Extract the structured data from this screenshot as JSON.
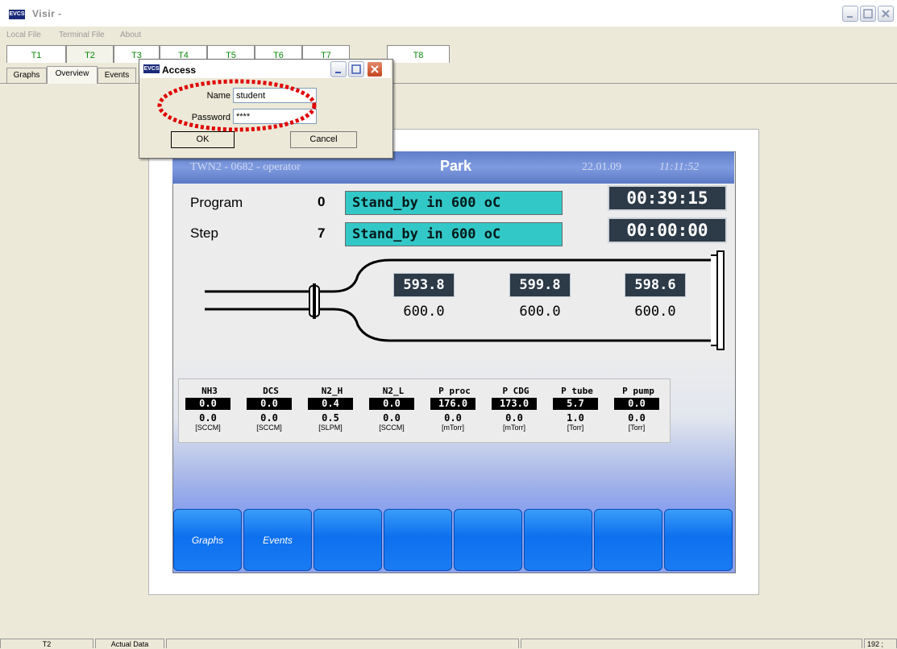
{
  "app": {
    "title": "Visir  -",
    "icon_text": "EVCS"
  },
  "menu": [
    "Local File",
    "Terminal File",
    "About"
  ],
  "tube_tabs": [
    {
      "label": "T1"
    },
    {
      "label": "T2"
    },
    {
      "label": "T3"
    },
    {
      "label": "T4"
    },
    {
      "label": "T5"
    },
    {
      "label": "T6"
    },
    {
      "label": "T7"
    },
    {
      "label": "T8"
    }
  ],
  "sub_tabs": [
    {
      "label": "Graphs"
    },
    {
      "label": "Overview",
      "active": true
    },
    {
      "label": "Events"
    }
  ],
  "hmi": {
    "id": "TWN2 - 0682 -  operator",
    "mode": "Park",
    "date": "22.01.09",
    "time": "11:11:52",
    "program_label": "Program",
    "program_num": "0",
    "program_text": "Stand_by in 600 oC",
    "program_timer": "00:39:15",
    "step_label": "Step",
    "step_num": "7",
    "step_text": "Stand_by in 600 oC",
    "step_timer": "00:00:00",
    "zones": [
      {
        "actual": "593.8",
        "setpoint": "600.0"
      },
      {
        "actual": "599.8",
        "setpoint": "600.0"
      },
      {
        "actual": "598.6",
        "setpoint": "600.0"
      }
    ],
    "gases": [
      {
        "name": "NH3",
        "actual": "0.0",
        "setpoint": "0.0",
        "unit": "[SCCM]"
      },
      {
        "name": "DCS",
        "actual": "0.0",
        "setpoint": "0.0",
        "unit": "[SCCM]"
      },
      {
        "name": "N2_H",
        "actual": "0.4",
        "setpoint": "0.5",
        "unit": "[SLPM]"
      },
      {
        "name": "N2_L",
        "actual": "0.0",
        "setpoint": "0.0",
        "unit": "[SCCM]"
      },
      {
        "name": "P proc",
        "actual": "176.0",
        "setpoint": "0.0",
        "unit": "[mTorr]"
      },
      {
        "name": "P CDG",
        "actual": "173.0",
        "setpoint": "0.0",
        "unit": "[mTorr]"
      },
      {
        "name": "P tube",
        "actual": "5.7",
        "setpoint": "1.0",
        "unit": "[Torr]"
      },
      {
        "name": "P pump",
        "actual": "0.0",
        "setpoint": "0.0",
        "unit": "[Torr]"
      }
    ],
    "softkeys": [
      "Graphs",
      "Events",
      "",
      "",
      "",
      "",
      "",
      ""
    ]
  },
  "dialog": {
    "title": "Access",
    "name_label": "Name",
    "name_value": "student",
    "password_label": "Password",
    "password_value": "****",
    "ok_label": "OK",
    "cancel_label": "Cancel",
    "highlight_color": "#e00000"
  },
  "status": {
    "tube": "T2",
    "mode": "Actual Data",
    "right": "192 ;"
  }
}
